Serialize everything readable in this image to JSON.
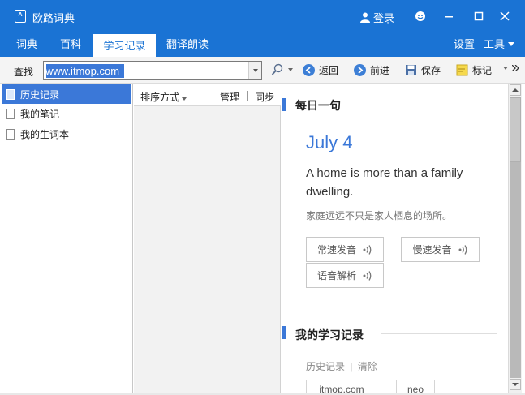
{
  "window": {
    "title": "欧路词典",
    "icon_text": "dict",
    "login_label": "登录",
    "accent": "#1a73d4"
  },
  "tabs": [
    {
      "label": "词典",
      "active": false
    },
    {
      "label": "百科",
      "active": false
    },
    {
      "label": "学习记录",
      "active": true
    },
    {
      "label": "翻译朗读",
      "active": false
    }
  ],
  "right_menu": {
    "settings": "设置",
    "tools": "工具"
  },
  "toolbar": {
    "find_label": "查找",
    "search_value": "www.itmop.com",
    "back": "返回",
    "forward": "前进",
    "save": "保存",
    "mark": "标记"
  },
  "left_nav": [
    {
      "label": "历史记录",
      "active": true
    },
    {
      "label": "我的笔记",
      "active": false
    },
    {
      "label": "我的生词本",
      "active": false
    }
  ],
  "mid_header": {
    "sort": "排序方式",
    "manage": "管理",
    "sync": "同步"
  },
  "daily": {
    "section_title": "每日一句",
    "date": "July 4",
    "english": "A home is more than a family dwelling.",
    "chinese": "家庭远远不只是家人栖息的场所。",
    "buttons": {
      "normal": "常速发音",
      "slow": "慢速发音",
      "analysis": "语音解析"
    }
  },
  "records": {
    "section_title": "我的学习记录",
    "history_link": "历史记录",
    "separator": "|",
    "clear_link": "清除",
    "chips": [
      "itmop.com",
      "neo"
    ]
  }
}
